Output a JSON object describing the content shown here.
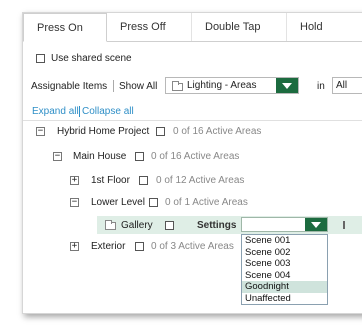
{
  "tabs": [
    "Press On",
    "Press Off",
    "Double Tap",
    "Hold"
  ],
  "use_shared_scene_label": "Use shared scene",
  "filter": {
    "assignable_label": "Assignable Items",
    "show_all_label": "Show All",
    "dropdown_value": "Lighting - Areas",
    "in_label": "in",
    "in_value": "All"
  },
  "links": {
    "expand_all": "Expand all",
    "collapse_all": "Collapse all"
  },
  "tree": {
    "project": {
      "toggle": "−",
      "label": "Hybrid Home Project",
      "status": "0 of 16 Active Areas"
    },
    "main_house": {
      "toggle": "−",
      "label": "Main House",
      "status": "0 of 16 Active Areas"
    },
    "first_floor": {
      "toggle": "+",
      "label": "1st Floor",
      "status": "0 of 12 Active Areas"
    },
    "lower_level": {
      "toggle": "−",
      "label": "Lower Level",
      "status": "0 of 1 Active Areas"
    },
    "gallery": {
      "label": "Gallery",
      "settings_label": "Settings"
    },
    "exterior": {
      "toggle": "+",
      "label": "Exterior",
      "status": "0 of 3 Active Areas"
    }
  },
  "scene_options": [
    "Scene 001",
    "Scene 002",
    "Scene 003",
    "Scene 004",
    "Goodnight",
    "Unaffected"
  ],
  "scene_highlighted": "Goodnight",
  "colors": {
    "accent_dark_green": "#1c6b3f",
    "link_blue": "#2f8fc7",
    "highlight": "#cfe3dc",
    "gallery_row": "#dfeee6"
  }
}
